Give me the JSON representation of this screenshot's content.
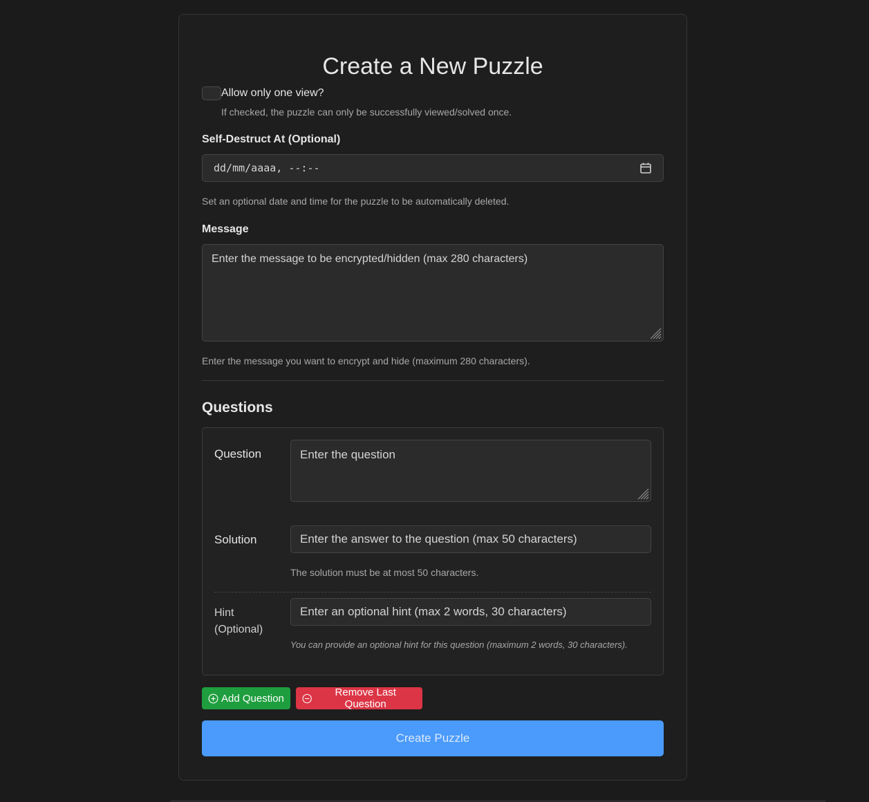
{
  "title": "Create a New Puzzle",
  "one_view": {
    "label": "Allow only one view?",
    "help": "If checked, the puzzle can only be successfully viewed/solved once.",
    "checked": false
  },
  "self_destruct": {
    "label": "Self-Destruct At (Optional)",
    "placeholder": "dd/mm/aaaa, --:--",
    "help": "Set an optional date and time for the puzzle to be automatically deleted."
  },
  "message": {
    "label": "Message",
    "placeholder": "Enter the message to be encrypted/hidden (max 280 characters)",
    "help": "Enter the message you want to encrypt and hide (maximum 280 characters)."
  },
  "questions": {
    "section_title": "Questions",
    "question_label": "Question",
    "question_placeholder": "Enter the question",
    "solution_label": "Solution",
    "solution_placeholder": "Enter the answer to the question (max 50 characters)",
    "solution_help": "The solution must be at most 50 characters.",
    "hint_label_line1": "Hint",
    "hint_label_line2": "(Optional)",
    "hint_placeholder": "Enter an optional hint (max 2 words, 30 characters)",
    "hint_help": "You can provide an optional hint for this question (maximum 2 words, 30 characters)."
  },
  "buttons": {
    "add_question": "Add Question",
    "remove_last_question": "Remove Last Question",
    "create_puzzle": "Create Puzzle"
  },
  "colors": {
    "add": "#1e9e3e",
    "remove": "#dc3545",
    "primary": "#4a9bfb"
  }
}
